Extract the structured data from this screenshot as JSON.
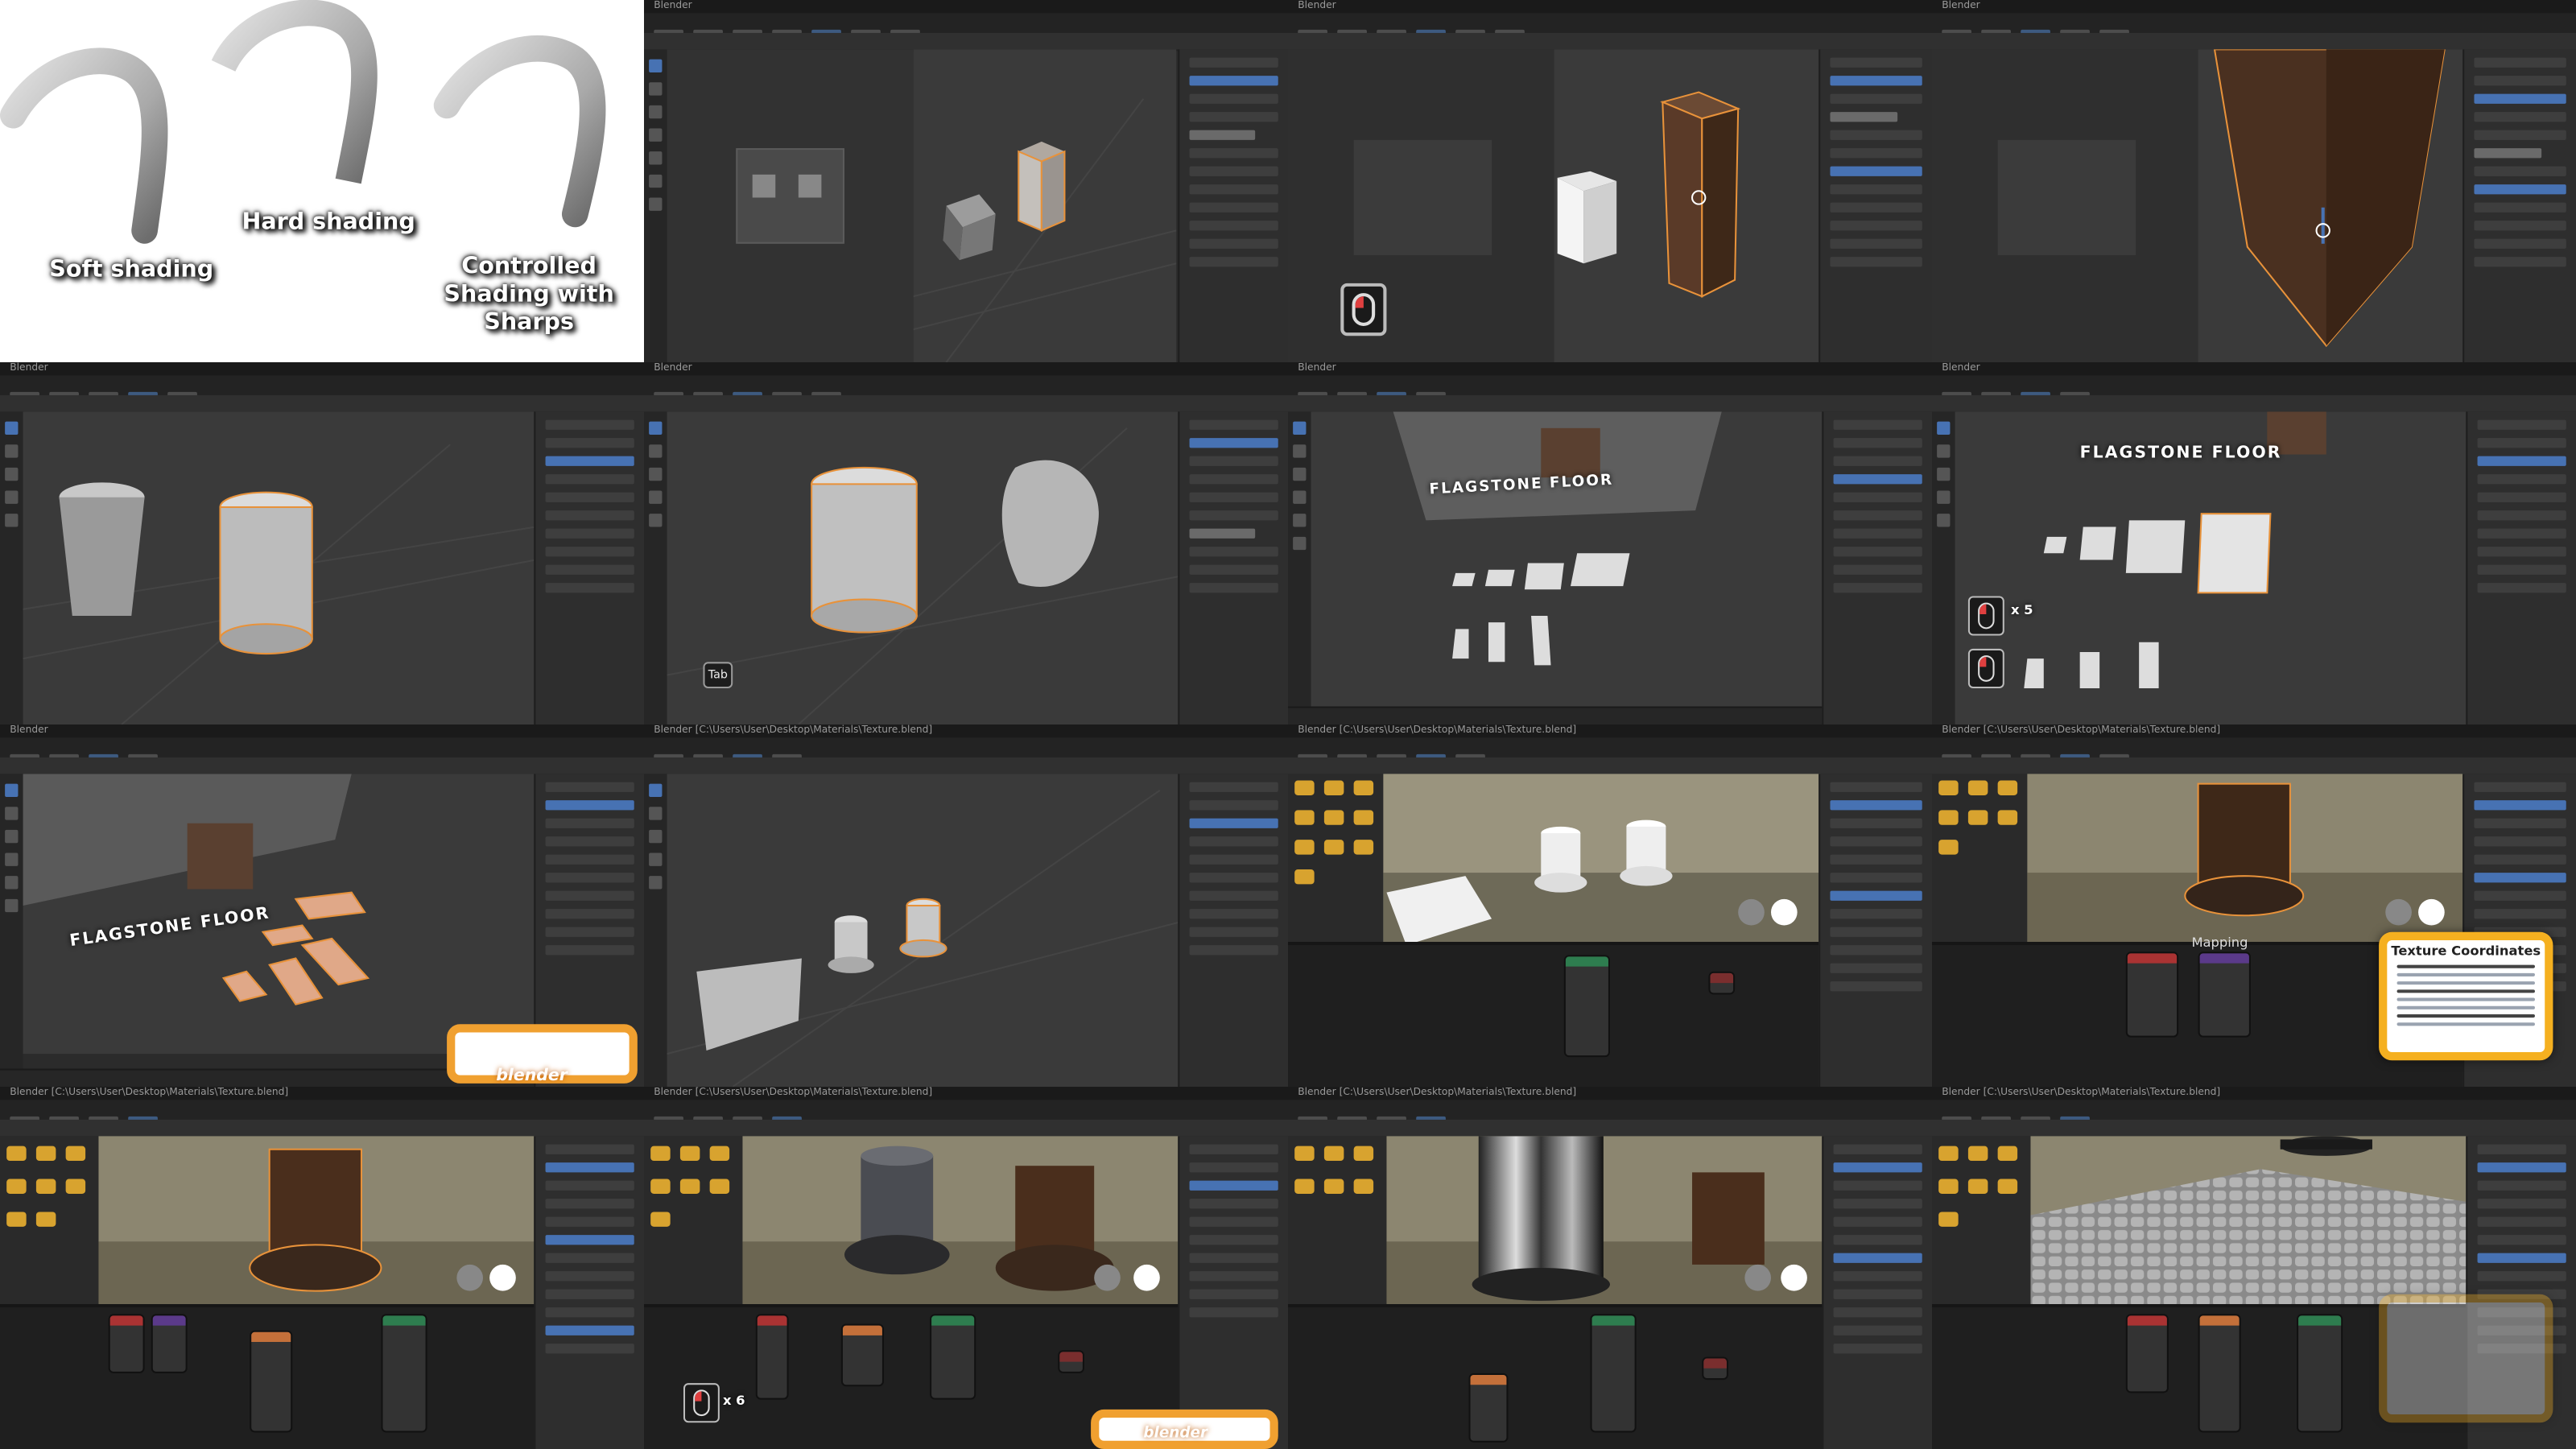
{
  "app": {
    "title": "Blender",
    "window_titles": [
      "Blender",
      "Blender [C:\\Users\\User\\Desktop\\Materials\\Texture.blend]"
    ]
  },
  "panel_shading": {
    "label_soft": "Soft shading",
    "label_hard": "Hard shading",
    "label_controlled": "Controlled Shading with Sharps"
  },
  "overlays": {
    "flagstone_label": "FLAGSTONE FLOOR",
    "tab_key": "Tab",
    "scroll_count_5": "x 5",
    "scroll_count_6": "x 6",
    "brand": "blender"
  },
  "texture_popup": {
    "title": "Texture Coordinates"
  },
  "nodes": {
    "mapping_label": "Mapping"
  },
  "colors": {
    "blender_bg": "#2b2b2b",
    "viewport_bg": "#3a3a3a",
    "selection_outline": "#e8923a",
    "accent_blue": "#4772b3",
    "brand_orange": "#f0a030"
  }
}
